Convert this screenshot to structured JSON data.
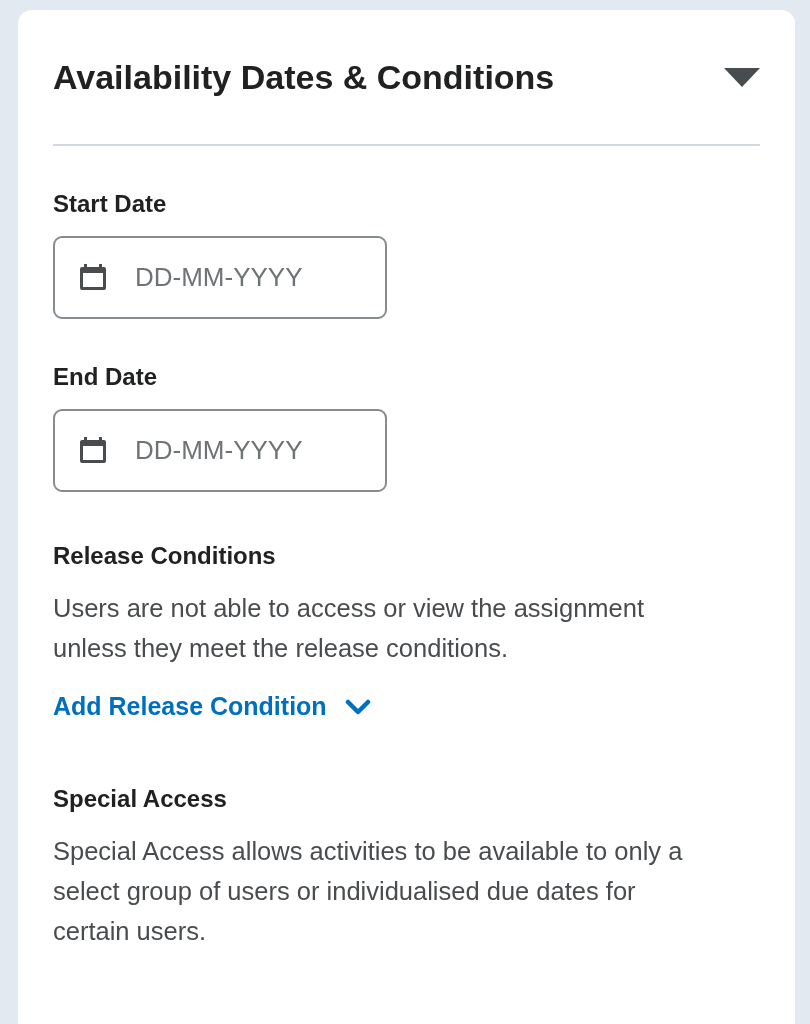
{
  "section": {
    "title": "Availability Dates & Conditions",
    "expanded": true
  },
  "start_date": {
    "label": "Start Date",
    "placeholder": "DD-MM-YYYY"
  },
  "end_date": {
    "label": "End Date",
    "placeholder": "DD-MM-YYYY"
  },
  "release_conditions": {
    "heading": "Release Conditions",
    "description": "Users are not able to access or view the assignment unless they meet the release conditions.",
    "link": "Add Release Condition"
  },
  "special_access": {
    "heading": "Special Access",
    "description": "Special Access allows activities to be available to only a select group of users or individualised due dates for certain users."
  }
}
